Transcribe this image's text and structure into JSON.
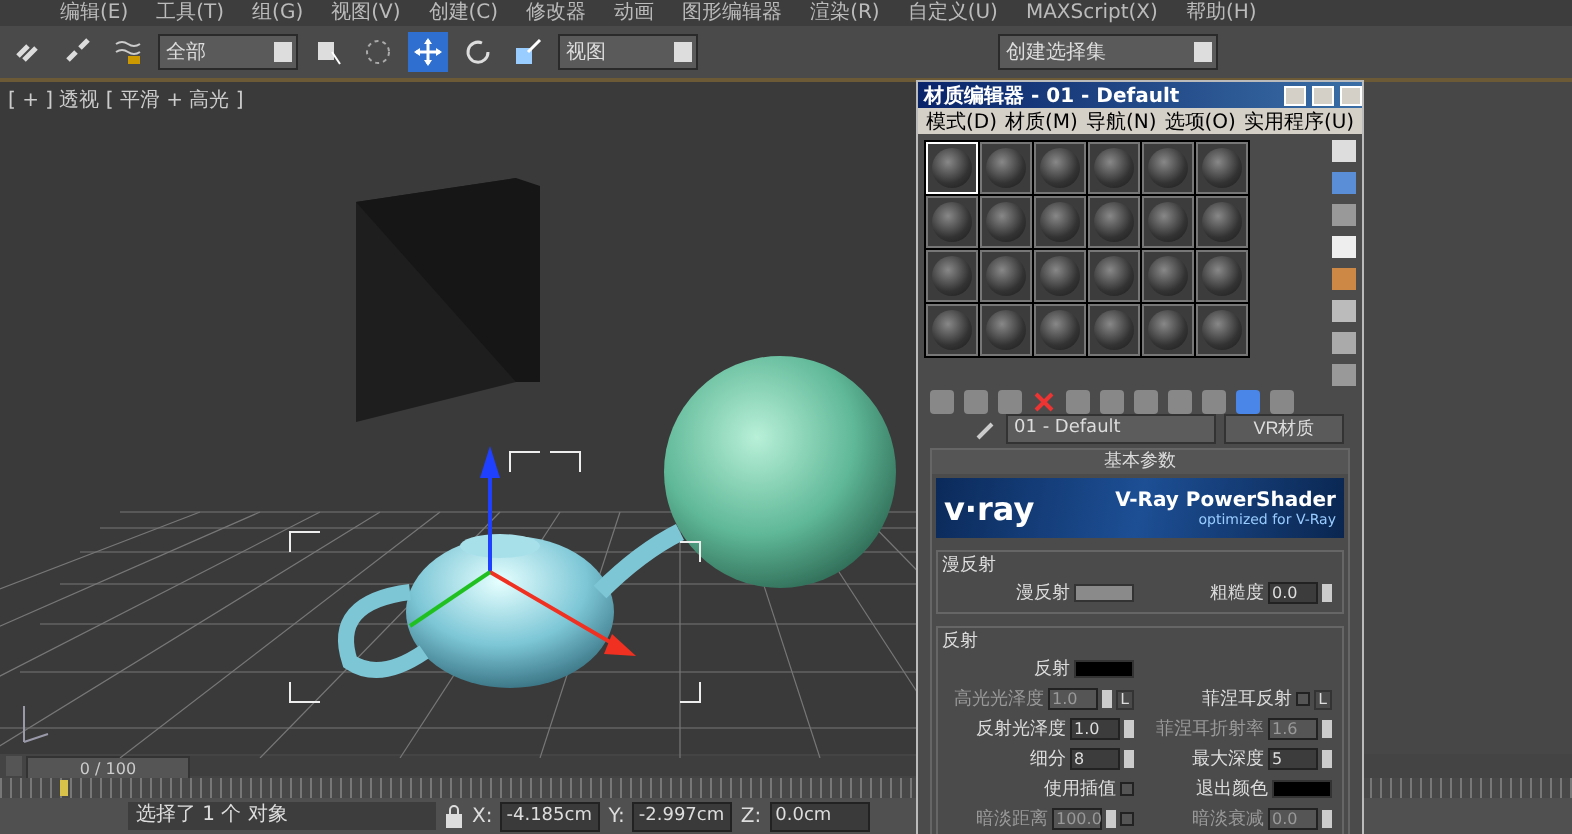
{
  "menu_bar": {
    "items": [
      "编辑(E)",
      "工具(T)",
      "组(G)",
      "视图(V)",
      "创建(C)",
      "修改器",
      "动画",
      "图形编辑器",
      "渲染(R)",
      "自定义(U)",
      "MAXScript(X)",
      "帮助(H)"
    ]
  },
  "toolbar": {
    "selection_filter": "全部",
    "reference_coord": "视图",
    "named_selection": "创建选择集",
    "tools": [
      {
        "selected": false
      },
      {
        "selected": false
      },
      {
        "selected": false
      },
      {
        "selected": false
      },
      {
        "selected": false
      },
      {
        "selected": true
      },
      {
        "selected": false
      },
      {
        "selected": false
      }
    ]
  },
  "viewport": {
    "label": "[ + ] 透视 [ 平滑 + 高光 ]"
  },
  "material_editor": {
    "title": "材质编辑器 - 01 - Default",
    "menu": [
      "模式(D)",
      "材质(M)",
      "导航(N)",
      "选项(O)",
      "实用程序(U)"
    ],
    "slots": [
      {
        "selected": true
      },
      {
        "selected": false
      },
      {
        "selected": false
      },
      {
        "selected": false
      },
      {
        "selected": false
      },
      {
        "selected": false
      },
      {
        "selected": false
      },
      {
        "selected": false
      },
      {
        "selected": false
      },
      {
        "selected": false
      },
      {
        "selected": false
      },
      {
        "selected": false
      },
      {
        "selected": false
      },
      {
        "selected": false
      },
      {
        "selected": false
      },
      {
        "selected": false
      },
      {
        "selected": false
      },
      {
        "selected": false
      },
      {
        "selected": false
      },
      {
        "selected": false
      },
      {
        "selected": false
      },
      {
        "selected": false
      },
      {
        "selected": false
      },
      {
        "selected": false
      }
    ],
    "material_name": "01 - Default",
    "material_type": "VR材质",
    "rollout_title": "基本参数",
    "banner": {
      "logo": "v·ray",
      "title": "V-Ray PowerShader",
      "subtitle": "optimized for V-Ray"
    },
    "groups": [
      {
        "title": "漫反射",
        "rows": [
          {
            "left": [
              {
                "kind": "swatch",
                "label": "漫反射",
                "color": "#8a8a8a"
              }
            ],
            "right": [
              {
                "kind": "spinner",
                "label": "粗糙度",
                "value": "0.0",
                "disabled": false
              }
            ]
          }
        ]
      },
      {
        "title": "反射",
        "rows": [
          {
            "left": [
              {
                "kind": "swatch",
                "label": "反射",
                "color": "#000000"
              }
            ],
            "right": []
          },
          {
            "left": [
              {
                "kind": "spinner",
                "label": "高光光泽度",
                "value": "1.0",
                "disabled": true
              },
              {
                "kind": "button",
                "label": "L"
              }
            ],
            "right": [
              {
                "kind": "checkbox",
                "label": "菲涅耳反射",
                "checked": false
              },
              {
                "kind": "button",
                "label": "L"
              }
            ]
          },
          {
            "left": [
              {
                "kind": "spinner",
                "label": "反射光泽度",
                "value": "1.0",
                "disabled": false
              }
            ],
            "right": [
              {
                "kind": "spinner",
                "label": "菲涅耳折射率",
                "value": "1.6",
                "disabled": true
              }
            ]
          },
          {
            "left": [
              {
                "kind": "spinner",
                "label": "细分",
                "value": "8",
                "disabled": false
              }
            ],
            "right": [
              {
                "kind": "spinner",
                "label": "最大深度",
                "value": "5",
                "disabled": false
              }
            ]
          },
          {
            "left": [
              {
                "kind": "checkbox",
                "label": "使用插值",
                "checked": false
              }
            ],
            "right": [
              {
                "kind": "swatch",
                "label": "退出颜色",
                "color": "#000000"
              }
            ]
          },
          {
            "left": [
              {
                "kind": "spinner",
                "label": "暗淡距离",
                "value": "100.0",
                "disabled": true
              },
              {
                "kind": "checkbox",
                "checked": false
              }
            ],
            "right": [
              {
                "kind": "spinner",
                "label": "暗淡衰减",
                "value": "0.0",
                "disabled": true
              }
            ]
          }
        ]
      }
    ]
  },
  "timeline": {
    "frame": "0 / 100",
    "level": 0
  },
  "status_bar": {
    "message": "选择了 1 个 对象",
    "x_label": "X:",
    "x": "-4.185cm",
    "y_label": "Y:",
    "y": "-2.997cm",
    "z_label": "Z:",
    "z": "0.0cm"
  }
}
